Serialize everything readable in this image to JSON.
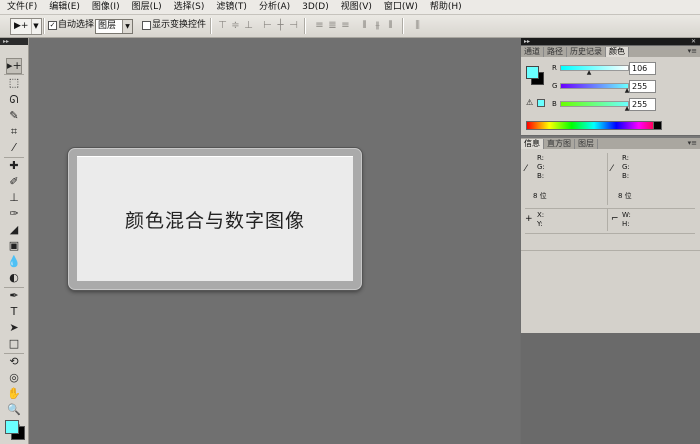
{
  "menu": [
    "文件(F)",
    "编辑(E)",
    "图像(I)",
    "图层(L)",
    "选择(S)",
    "滤镜(T)",
    "分析(A)",
    "3D(D)",
    "视图(V)",
    "窗口(W)",
    "帮助(H)"
  ],
  "options_bar": {
    "auto_select_label": "自动选择:",
    "auto_select_checked": "✓",
    "auto_select_target": "图层",
    "show_transform_label": "显示变换控件"
  },
  "canvas": {
    "text": "颜色混合与数字图像",
    "plate_color": "#ebebeb"
  },
  "color_panel": {
    "tabs": [
      "通道",
      "路径",
      "历史记录",
      "颜色"
    ],
    "active_tab": "颜色",
    "foreground_color": "#6affff",
    "background_color": "#000000",
    "channels": [
      {
        "label": "R",
        "value": "106"
      },
      {
        "label": "G",
        "value": "255"
      },
      {
        "label": "B",
        "value": "255"
      }
    ]
  },
  "info_panel": {
    "tabs": [
      "信息",
      "直方图",
      "图层"
    ],
    "active_tab": "信息",
    "left_rgb": [
      "R:",
      "G:",
      "B:"
    ],
    "right_rgb": [
      "R:",
      "G:",
      "B:"
    ],
    "bit_depth_left": "8 位",
    "bit_depth_right": "8 位",
    "xy": [
      "X:",
      "Y:"
    ],
    "wh": [
      "W:",
      "H:"
    ]
  }
}
